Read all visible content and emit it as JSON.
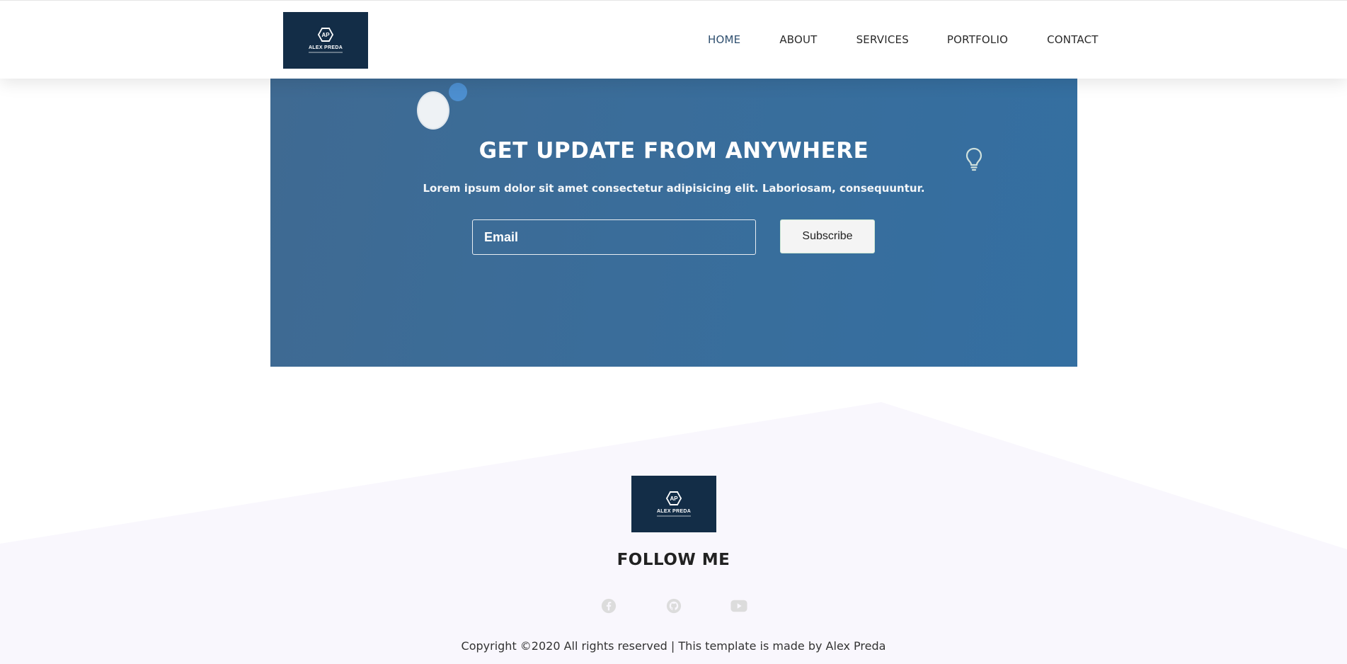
{
  "header": {
    "logo": {
      "initials": "AP",
      "name": "ALEX PREDA"
    },
    "nav": [
      {
        "label": "HOME",
        "active": true
      },
      {
        "label": "ABOUT"
      },
      {
        "label": "SERVICES"
      },
      {
        "label": "PORTFOLIO"
      },
      {
        "label": "CONTACT"
      }
    ]
  },
  "update": {
    "title": "GET UPDATE FROM ANYWHERE",
    "subtitle": "Lorem ipsum dolor sit amet consectetur adipisicing elit. Laboriosam, consequuntur.",
    "email_placeholder": "Email",
    "email_value": "",
    "subscribe_label": "Subscribe",
    "icons": [
      "lightbulb-icon"
    ]
  },
  "footer": {
    "logo": {
      "initials": "AP",
      "name": "ALEX PREDA"
    },
    "follow_title": "FOLLOW ME",
    "socials": [
      {
        "name": "facebook-icon"
      },
      {
        "name": "github-icon"
      },
      {
        "name": "youtube-icon"
      }
    ],
    "copyright": "Copyright ©2020 All rights reserved | This template is made by Alex Preda"
  },
  "colors": {
    "navy": "#132d47",
    "update_bg": "#3a6d9a",
    "footer_bg": "#f9f7fd",
    "accent_blue": "#4d8fd0"
  }
}
